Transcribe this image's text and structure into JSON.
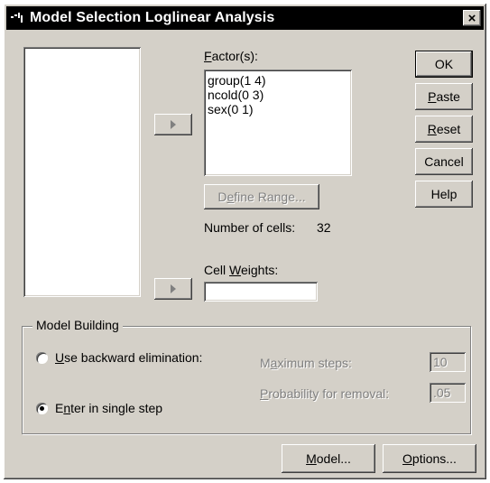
{
  "window": {
    "title": "Model Selection Loglinear Analysis",
    "close_glyph": "×"
  },
  "variables_list": {
    "items": []
  },
  "factors": {
    "label_pre": "",
    "label_u": "F",
    "label_post": "actor(s):",
    "items": [
      "group(1 4)",
      "ncold(0 3)",
      "sex(0 1)"
    ]
  },
  "define_range": {
    "label_pre": "D",
    "label_u": "e",
    "label_post": "fine Range..."
  },
  "cells": {
    "label": "Number of cells:",
    "value": "32"
  },
  "cell_weights": {
    "label_pre": "Cell ",
    "label_u": "W",
    "label_post": "eights:",
    "value": ""
  },
  "side_buttons": {
    "ok": "OK",
    "paste_u": "P",
    "paste_rest": "aste",
    "reset_u": "R",
    "reset_rest": "eset",
    "cancel": "Cancel",
    "help": "Help"
  },
  "model_building": {
    "legend": "Model Building",
    "backward": {
      "label_u": "U",
      "label_rest": "se backward elimination:",
      "checked": false
    },
    "single": {
      "label_pre": "E",
      "label_u": "n",
      "label_post": "ter in single step",
      "checked": true
    },
    "max_steps": {
      "label_pre": "M",
      "label_u": "a",
      "label_post": "ximum steps:",
      "value": "10"
    },
    "prob_removal": {
      "label_u": "P",
      "label_rest": "robability for removal:",
      "value": ".05"
    }
  },
  "bottom_buttons": {
    "model_u": "M",
    "model_rest": "odel...",
    "options_u": "O",
    "options_rest": "ptions..."
  },
  "icons": {
    "app": "spss-dialog-icon",
    "arrow": "right-arrow-icon",
    "close": "close-icon"
  }
}
